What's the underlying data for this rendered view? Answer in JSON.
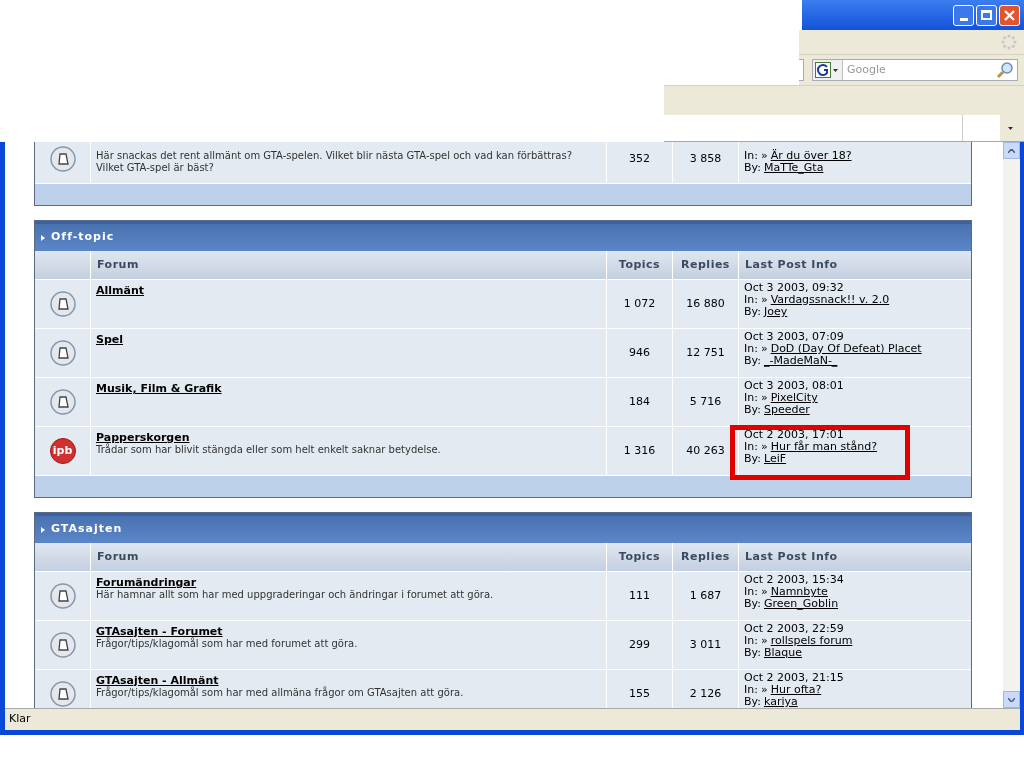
{
  "browser": {
    "search_placeholder": "Google",
    "status": "Klar"
  },
  "categories": [
    {
      "forums": [
        {
          "kind": "book",
          "description": "Här snackas det rent allmänt om GTA-spelen. Vilket blir nästa GTA-spel och vad kan förbättras? Vilket GTA-spel är bäst?",
          "topics": "352",
          "replies": "3 858",
          "in_label": "In:",
          "arrow": "»",
          "last_in": "Är du över 18?",
          "by_label": "By:",
          "last_by": "MaTTe_Gta",
          "highlighted": false
        }
      ]
    },
    {
      "title": "Off-topic",
      "columns": [
        "Forum",
        "Topics",
        "Replies",
        "Last Post Info"
      ],
      "forums": [
        {
          "kind": "book",
          "name": "Allmänt",
          "topics": "1 072",
          "replies": "16 880",
          "last_date": "Oct 3 2003, 09:32",
          "in_label": "In:",
          "arrow": "»",
          "last_in": "Vardagssnack!! v. 2.0",
          "by_label": "By:",
          "last_by": "Joey",
          "highlighted": false
        },
        {
          "kind": "book",
          "name": "Spel",
          "topics": "946",
          "replies": "12 751",
          "last_date": "Oct 3 2003, 07:09",
          "in_label": "In:",
          "arrow": "»",
          "last_in": "DoD (Day Of Defeat) Placet",
          "by_label": "By:",
          "last_by": "_-MadeMaN-_",
          "highlighted": false
        },
        {
          "kind": "book",
          "name": "Musik, Film & Grafik",
          "topics": "184",
          "replies": "5 716",
          "last_date": "Oct 3 2003, 08:01",
          "in_label": "In:",
          "arrow": "»",
          "last_in": "PixelCity",
          "by_label": "By:",
          "last_by": "Speeder",
          "highlighted": false
        },
        {
          "kind": "badge",
          "badge": "ipb",
          "name": "Papperskorgen",
          "description": "Trådar som har blivit stängda eller som helt enkelt saknar betydelse.",
          "topics": "1 316",
          "replies": "40 263",
          "last_date": "Oct 2 2003, 17:01",
          "in_label": "In:",
          "arrow": "»",
          "last_in": "Hur får man stånd?",
          "by_label": "By:",
          "last_by": "LeiF",
          "highlighted": true
        }
      ]
    },
    {
      "title": "GTAsajten",
      "columns": [
        "Forum",
        "Topics",
        "Replies",
        "Last Post Info"
      ],
      "forums": [
        {
          "kind": "book",
          "name": "Forumändringar",
          "description": "Här hamnar allt som har med uppgraderingar och ändringar i forumet att göra.",
          "topics": "111",
          "replies": "1 687",
          "last_date": "Oct 2 2003, 15:34",
          "in_label": "In:",
          "arrow": "»",
          "last_in": "Namnbyte",
          "by_label": "By:",
          "last_by": "Green_Goblin",
          "highlighted": false
        },
        {
          "kind": "book",
          "name": "GTAsajten - Forumet",
          "description": "Frågor/tips/klagomål som har med forumet att göra.",
          "topics": "299",
          "replies": "3 011",
          "last_date": "Oct 2 2003, 22:59",
          "in_label": "In:",
          "arrow": "»",
          "last_in": "rollspels forum",
          "by_label": "By:",
          "last_by": "Blaque",
          "highlighted": false
        },
        {
          "kind": "book",
          "name": "GTAsajten - Allmänt",
          "description": "Frågor/tips/klagomål som har med allmäna frågor om GTAsajten att göra.",
          "topics": "155",
          "replies": "2 126",
          "last_date": "Oct 2 2003, 21:15",
          "in_label": "In:",
          "arrow": "»",
          "last_in": "Hur ofta?",
          "by_label": "By:",
          "last_by": "kariya",
          "highlighted": false
        }
      ]
    }
  ]
}
